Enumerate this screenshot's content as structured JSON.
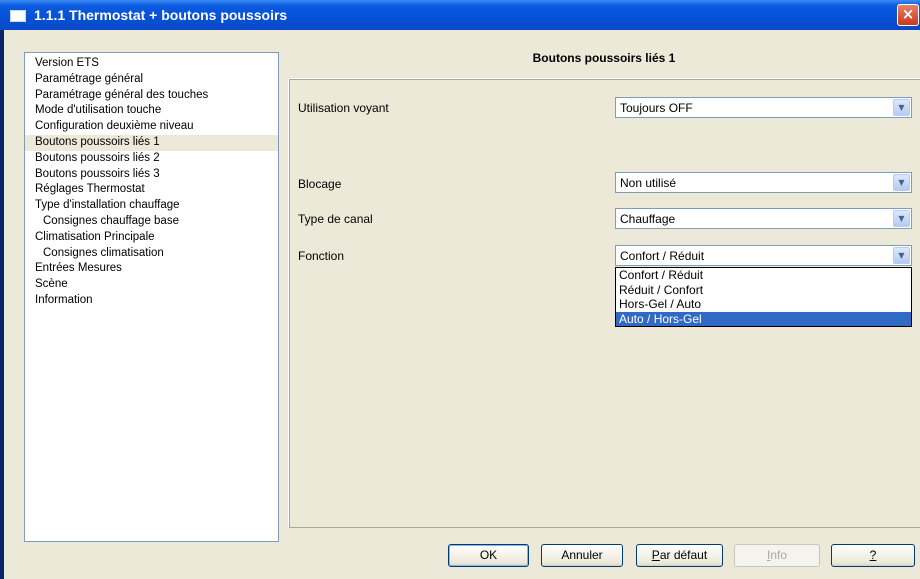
{
  "window": {
    "title": "1.1.1 Thermostat + boutons poussoirs",
    "close_label": "×"
  },
  "tree": {
    "items": [
      {
        "label": "Version ETS",
        "indent": false,
        "selected": false
      },
      {
        "label": "Paramétrage général",
        "indent": false,
        "selected": false
      },
      {
        "label": "Paramétrage général des touches",
        "indent": false,
        "selected": false
      },
      {
        "label": "Mode d'utilisation touche",
        "indent": false,
        "selected": false
      },
      {
        "label": "Configuration deuxième niveau",
        "indent": false,
        "selected": false
      },
      {
        "label": "Boutons poussoirs liés 1",
        "indent": false,
        "selected": true
      },
      {
        "label": "Boutons poussoirs liés 2",
        "indent": false,
        "selected": false
      },
      {
        "label": "Boutons poussoirs liés 3",
        "indent": false,
        "selected": false
      },
      {
        "label": "Réglages Thermostat",
        "indent": false,
        "selected": false
      },
      {
        "label": "Type d'installation chauffage",
        "indent": false,
        "selected": false
      },
      {
        "label": "Consignes chauffage base",
        "indent": true,
        "selected": false
      },
      {
        "label": "Climatisation Principale",
        "indent": false,
        "selected": false
      },
      {
        "label": "Consignes climatisation",
        "indent": true,
        "selected": false
      },
      {
        "label": "Entrées Mesures",
        "indent": false,
        "selected": false
      },
      {
        "label": "Scène",
        "indent": false,
        "selected": false
      },
      {
        "label": "Information",
        "indent": false,
        "selected": false
      }
    ]
  },
  "page": {
    "title": "Boutons poussoirs liés 1"
  },
  "fields": {
    "utilisation_voyant": {
      "label": "Utilisation voyant",
      "value": "Toujours OFF"
    },
    "blocage": {
      "label": "Blocage",
      "value": "Non utilisé"
    },
    "type_canal": {
      "label": "Type de canal",
      "value": "Chauffage"
    },
    "fonction": {
      "label": "Fonction",
      "value": "Confort / Réduit",
      "options": [
        "Confort / Réduit",
        "Réduit / Confort",
        "Hors-Gel / Auto",
        "Auto / Hors-Gel"
      ],
      "highlighted": "Auto / Hors-Gel"
    }
  },
  "buttons": {
    "ok": "OK",
    "cancel": "Annuler",
    "default_mnemonic": "P",
    "default_rest": "ar défaut",
    "info_mnemonic": "I",
    "info_rest": "nfo",
    "help": "?"
  },
  "icons": {
    "dropdown": "chevron-down-icon",
    "close": "close-icon",
    "app": "window-icon"
  },
  "colors": {
    "titlebar": "#0650d6",
    "selection": "#316ac5",
    "dialog_bg": "#ece9d8"
  }
}
